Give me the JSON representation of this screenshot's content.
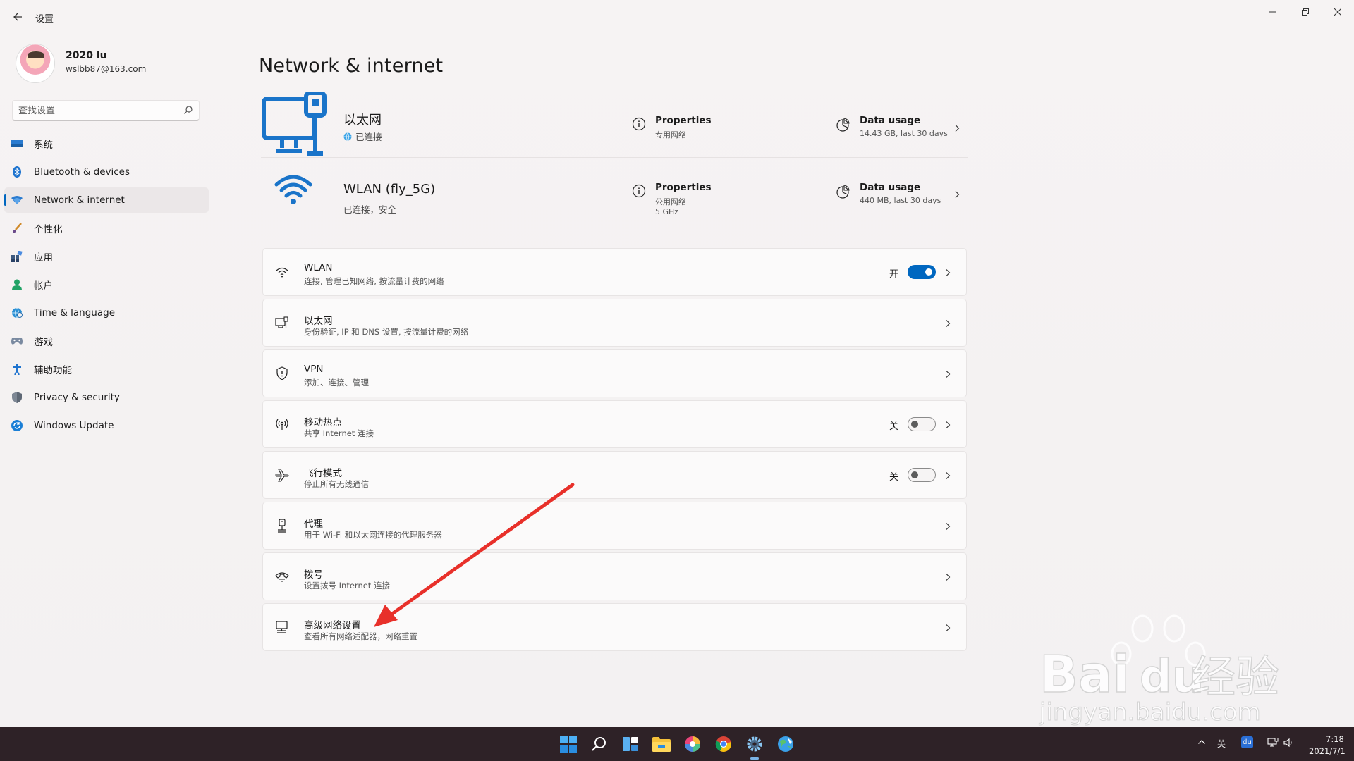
{
  "window": {
    "app_title": "设置",
    "controls": {
      "minimize": "—",
      "maximize": "❐",
      "close": "✕"
    }
  },
  "profile": {
    "name": "2020 lu",
    "email": "wslbb87@163.com"
  },
  "search": {
    "placeholder": "查找设置"
  },
  "sidebar": {
    "items": [
      {
        "label": "系统",
        "icon": "monitor-icon"
      },
      {
        "label": "Bluetooth & devices",
        "icon": "bluetooth-icon"
      },
      {
        "label": "Network & internet",
        "icon": "network-icon",
        "active": true
      },
      {
        "label": "个性化",
        "icon": "brush-icon"
      },
      {
        "label": "应用",
        "icon": "apps-icon"
      },
      {
        "label": "帐户",
        "icon": "person-icon"
      },
      {
        "label": "Time & language",
        "icon": "globe-clock-icon"
      },
      {
        "label": "游戏",
        "icon": "gamepad-icon"
      },
      {
        "label": "辅助功能",
        "icon": "accessibility-icon"
      },
      {
        "label": "Privacy & security",
        "icon": "shield-icon"
      },
      {
        "label": "Windows Update",
        "icon": "update-icon"
      }
    ]
  },
  "main": {
    "title": "Network & internet",
    "ethernet": {
      "name": "以太网",
      "status": "已连接",
      "properties_title": "Properties",
      "properties_sub": "专用网络",
      "usage_title": "Data usage",
      "usage_sub": "14.43 GB, last 30 days"
    },
    "wlan": {
      "name": "WLAN (fly_5G)",
      "status": "已连接，安全",
      "properties_title": "Properties",
      "properties_sub": "公用网络",
      "properties_sub2": "5 GHz",
      "usage_title": "Data usage",
      "usage_sub": "440 MB, last 30 days"
    },
    "rows": [
      {
        "title": "WLAN",
        "sub": "连接, 管理已知网络, 按流量计费的网络",
        "icon": "wifi-icon",
        "toggle": "on",
        "toggle_label": "开"
      },
      {
        "title": "以太网",
        "sub": "身份验证, IP 和 DNS 设置, 按流量计费的网络",
        "icon": "ethernet-icon"
      },
      {
        "title": "VPN",
        "sub": "添加、连接、管理",
        "icon": "vpn-shield-icon"
      },
      {
        "title": "移动热点",
        "sub": "共享 Internet 连接",
        "icon": "hotspot-icon",
        "toggle": "off",
        "toggle_label": "关"
      },
      {
        "title": "飞行模式",
        "sub": "停止所有无线通信",
        "icon": "airplane-icon",
        "toggle": "off",
        "toggle_label": "关"
      },
      {
        "title": "代理",
        "sub": "用于 Wi-Fi 和以太网连接的代理服务器",
        "icon": "proxy-icon"
      },
      {
        "title": "拨号",
        "sub": "设置拨号 Internet 连接",
        "icon": "dialup-icon"
      },
      {
        "title": "高级网络设置",
        "sub": "查看所有网络适配器，网络重置",
        "icon": "advanced-network-icon"
      }
    ]
  },
  "watermark": {
    "brand": "Bai",
    "brand2": "du",
    "cn": "经验",
    "url": "jingyan.baidu.com"
  },
  "taskbar": {
    "tray": {
      "ime": "英",
      "app": "du"
    },
    "time": "7:18",
    "date": "2021/7/1"
  },
  "colors": {
    "accent": "#0067c0",
    "annotation": "#e8302a",
    "taskbar": "#2e2227"
  }
}
